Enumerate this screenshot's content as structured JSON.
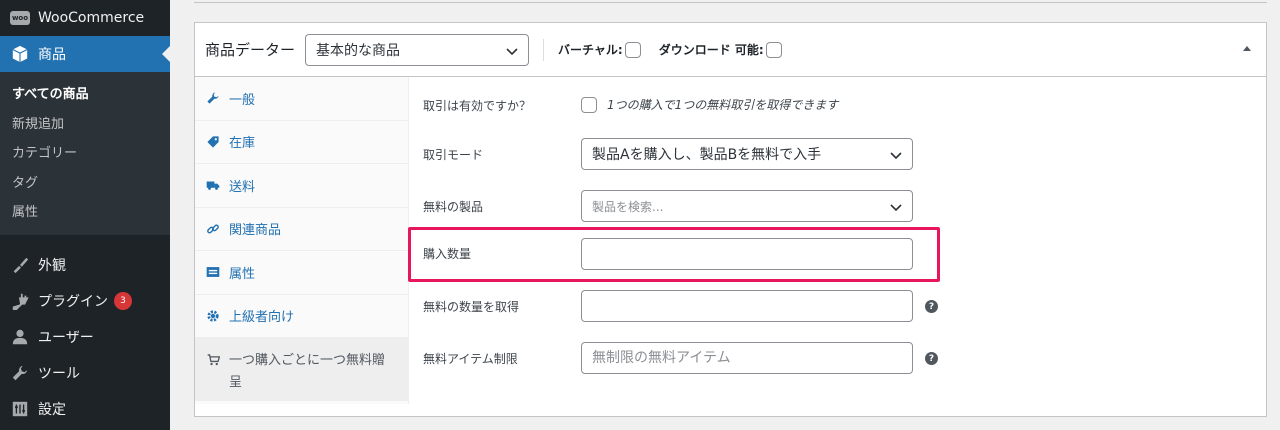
{
  "sidebar": {
    "woocommerce_label": "WooCommerce",
    "products_label": "商品",
    "submenu": [
      {
        "label": "すべての商品"
      },
      {
        "label": "新規追加"
      },
      {
        "label": "カテゴリー"
      },
      {
        "label": "タグ"
      },
      {
        "label": "属性"
      }
    ],
    "appearance_label": "外観",
    "plugins_label": "プラグイン",
    "plugins_badge": "3",
    "users_label": "ユーザー",
    "tools_label": "ツール",
    "settings_label": "設定",
    "woo_logo_text": "woo"
  },
  "product_data": {
    "title": "商品データー",
    "product_type_selected": "基本的な商品",
    "virtual_label": "バーチャル:",
    "downloadable_label": "ダウンロード 可能:",
    "tabs": [
      {
        "label": "一般",
        "icon": "wrench-icon"
      },
      {
        "label": "在庫",
        "icon": "tag-icon"
      },
      {
        "label": "送料",
        "icon": "truck-icon"
      },
      {
        "label": "関連商品",
        "icon": "link-icon"
      },
      {
        "label": "属性",
        "icon": "list-icon"
      },
      {
        "label": "上級者向け",
        "icon": "gear-icon"
      },
      {
        "label": "一つ購入ごとに一つ無料贈呈",
        "icon": "cart-icon"
      }
    ]
  },
  "deal": {
    "enabled_label": "取引は有効ですか？",
    "enabled_desc": "1つの購入で1つの無料取引を取得できます",
    "mode_label": "取引モード",
    "mode_value": "製品Aを購入し、製品Bを無料で入手",
    "free_product_label": "無料の製品",
    "free_product_placeholder": "製品を検索...",
    "purchase_qty_label": "購入数量",
    "free_qty_label": "無料の数量を取得",
    "item_limit_label": "無料アイテム制限",
    "item_limit_placeholder": "無制限の無料アイテム",
    "help_glyph": "?"
  },
  "colors": {
    "accent": "#2271b1",
    "sidebar_bg": "#1d2327",
    "highlight": "#e8175d",
    "badge": "#d63638"
  }
}
